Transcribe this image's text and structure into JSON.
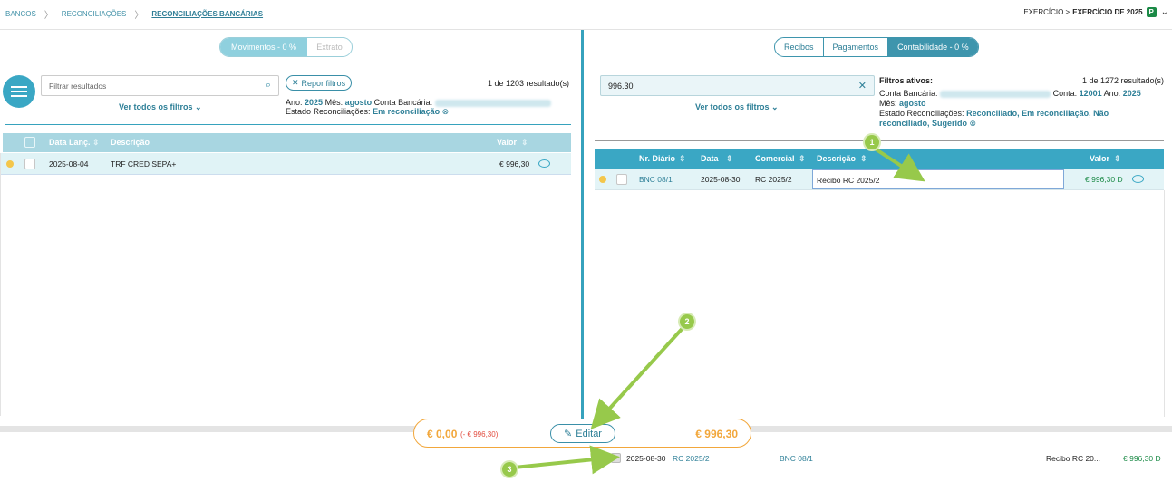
{
  "breadcrumb": {
    "items": [
      "BANCOS",
      "RECONCILIAÇÕES",
      "RECONCILIAÇÕES BANCÁRIAS"
    ]
  },
  "exercise": {
    "label": "EXERCÍCIO > ",
    "value": "EXERCÍCIO DE 2025",
    "badge": "P"
  },
  "left": {
    "toggle": [
      "Movimentos - 0 %",
      "Extrato"
    ],
    "search_placeholder": "Filtrar resultados",
    "repor": "Repor filtros",
    "count": "1 de 1203 resultado(s)",
    "ver_filtros": "Ver todos os filtros",
    "filters": {
      "ano_label": "Ano:",
      "ano": "2025",
      "mes_label": "Mês:",
      "mes": "agosto",
      "conta_label": "Conta Bancária:",
      "estado_label": "Estado Reconciliações:",
      "estado": "Em reconciliação"
    },
    "columns": [
      "Data Lanç.",
      "Descrição",
      "Valor"
    ],
    "row": {
      "date": "2025-08-04",
      "desc": "TRF CRED SEPA+",
      "value": "€ 996,30"
    }
  },
  "right": {
    "tabs": [
      "Recibos",
      "Pagamentos",
      "Contabilidade - 0 %"
    ],
    "search_value": "996.30",
    "ver_filtros": "Ver todos os filtros",
    "active_label": "Filtros ativos:",
    "count": "1 de 1272 resultado(s)",
    "filters": {
      "conta_label": "Conta Bancária:",
      "conta2_label": "Conta:",
      "conta": "12001",
      "ano_label": "Ano:",
      "ano": "2025",
      "mes_label": "Mês:",
      "mes": "agosto",
      "estado_label": "Estado Reconciliações:",
      "estado": "Reconciliado, Em reconciliação, Não reconciliado, Sugerido"
    },
    "columns": [
      "Nr. Diário",
      "Data",
      "Comercial",
      "Descrição",
      "Valor"
    ],
    "row": {
      "diario": "BNC 08/1",
      "date": "2025-08-30",
      "comercial": "RC 2025/2",
      "desc": "Recibo RC 2025/2",
      "value": "€ 996,30 D"
    }
  },
  "bottom": {
    "left_value": "€ 0,00",
    "left_note": "(- € 996,30)",
    "edit": "Editar",
    "right_value": "€ 996,30",
    "row": {
      "date": "2025-08-30",
      "rc": "RC 2025/2",
      "diario": "BNC 08/1",
      "desc": "Recibo RC 20...",
      "value": "€ 996,30 D"
    }
  },
  "markers": [
    "1",
    "2",
    "3"
  ],
  "colors": {
    "accent": "#3aa7c4",
    "annotation": "#97c94b",
    "highlight": "#f2a73b",
    "positive": "#1b8a46",
    "negative": "#e24c3f"
  }
}
